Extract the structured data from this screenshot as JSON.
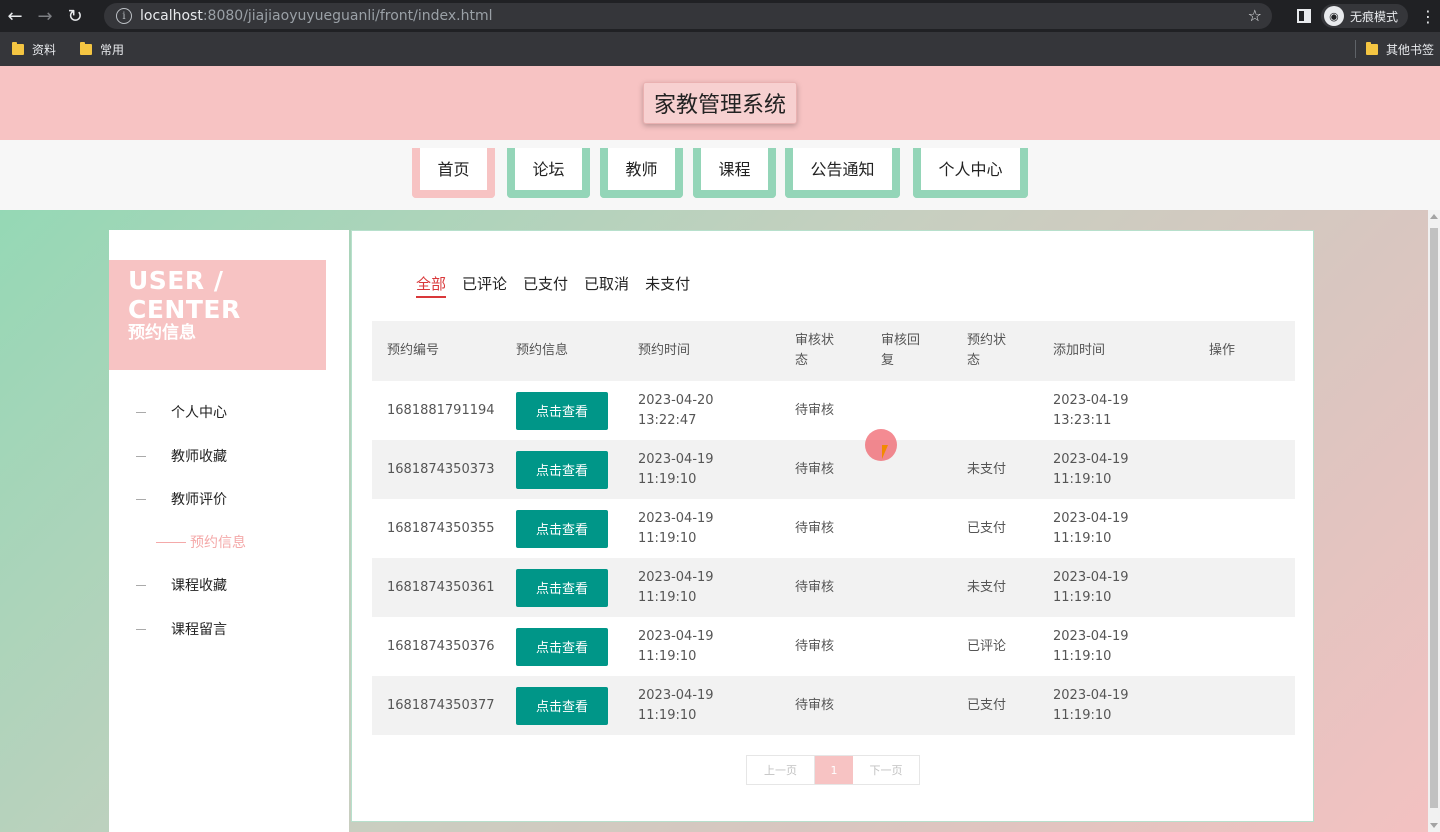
{
  "browser": {
    "url_host": "localhost",
    "url_path": ":8080/jiajiaoyuyueguanli/front/index.html",
    "incognito_label": "无痕模式",
    "bookmarks": [
      "资料",
      "常用"
    ],
    "other_bookmarks": "其他书签"
  },
  "site": {
    "title": "家教管理系统"
  },
  "nav": [
    "首页",
    "论坛",
    "教师",
    "课程",
    "公告通知",
    "个人中心"
  ],
  "sidebar": {
    "title_en": "USER / CENTER",
    "title_cn": "预约信息",
    "items": [
      "个人中心",
      "教师收藏",
      "教师评价",
      "预约信息",
      "课程收藏",
      "课程留言"
    ],
    "active_index": 3
  },
  "tabs": [
    "全部",
    "已评论",
    "已支付",
    "已取消",
    "未支付"
  ],
  "table": {
    "headers": [
      "预约编号",
      "预约信息",
      "预约时间",
      "审核状态",
      "审核回复",
      "预约状态",
      "添加时间",
      "操作"
    ],
    "headers_wrapped": {
      "3": [
        "审核状",
        "态"
      ],
      "4": [
        "审核回",
        "复"
      ],
      "5": [
        "预约状",
        "态"
      ]
    },
    "view_label": "点击查看",
    "rows": [
      {
        "id": "1681881791194",
        "time_date": "2023-04-20",
        "time_clock": "13:22:47",
        "audit": "待审核",
        "reply": "",
        "status": "",
        "add_date": "2023-04-19",
        "add_clock": "13:23:11"
      },
      {
        "id": "1681874350373",
        "time_date": "2023-04-19",
        "time_clock": "11:19:10",
        "audit": "待审核",
        "reply": "",
        "status": "未支付",
        "add_date": "2023-04-19",
        "add_clock": "11:19:10"
      },
      {
        "id": "1681874350355",
        "time_date": "2023-04-19",
        "time_clock": "11:19:10",
        "audit": "待审核",
        "reply": "",
        "status": "已支付",
        "add_date": "2023-04-19",
        "add_clock": "11:19:10"
      },
      {
        "id": "1681874350361",
        "time_date": "2023-04-19",
        "time_clock": "11:19:10",
        "audit": "待审核",
        "reply": "",
        "status": "未支付",
        "add_date": "2023-04-19",
        "add_clock": "11:19:10"
      },
      {
        "id": "1681874350376",
        "time_date": "2023-04-19",
        "time_clock": "11:19:10",
        "audit": "待审核",
        "reply": "",
        "status": "已评论",
        "add_date": "2023-04-19",
        "add_clock": "11:19:10"
      },
      {
        "id": "1681874350377",
        "time_date": "2023-04-19",
        "time_clock": "11:19:10",
        "audit": "待审核",
        "reply": "",
        "status": "已支付",
        "add_date": "2023-04-19",
        "add_clock": "11:19:10"
      }
    ]
  },
  "pager": {
    "prev": "上一页",
    "current": "1",
    "next": "下一页"
  },
  "colors": {
    "accent_pink": "#f7c3c3",
    "accent_green": "#94d5b8",
    "button_teal": "#009688",
    "active_tab_red": "#d9383a"
  },
  "icons": [
    "back-icon",
    "forward-icon",
    "reload-icon",
    "info-icon",
    "star-icon",
    "side-panel-icon",
    "incognito-icon",
    "menu-icon",
    "folder-icon"
  ]
}
